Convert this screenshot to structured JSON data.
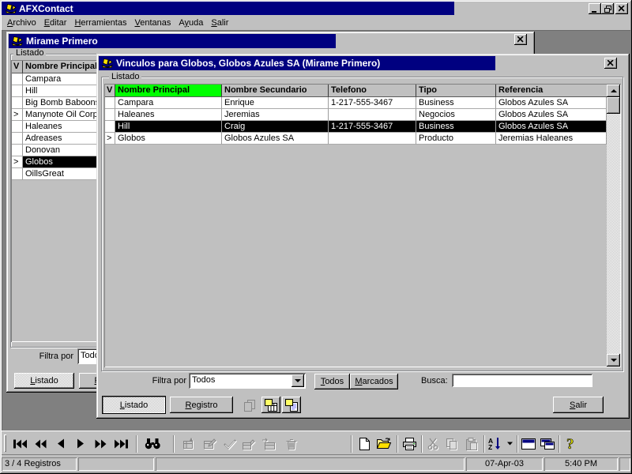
{
  "app": {
    "title": "AFXContact"
  },
  "menu": {
    "items": [
      {
        "label": "Archivo"
      },
      {
        "label": "Editar"
      },
      {
        "label": "Herramientas"
      },
      {
        "label": "Ventanas"
      },
      {
        "label": "Ayuda"
      },
      {
        "label": "Salir"
      }
    ]
  },
  "mirame_window": {
    "title": "Mirame Primero",
    "groupbox_label": "Listado",
    "table": {
      "headers": [
        "V",
        "Nombre Principal"
      ],
      "rows": [
        {
          "v": "",
          "cells": [
            "Campara"
          ]
        },
        {
          "v": "",
          "cells": [
            "Hill"
          ]
        },
        {
          "v": "",
          "cells": [
            "Big Bomb Baboons"
          ]
        },
        {
          "v": ">",
          "cells": [
            "Manynote Oil Corp."
          ]
        },
        {
          "v": "",
          "cells": [
            "Haleanes"
          ]
        },
        {
          "v": "",
          "cells": [
            "Adreases"
          ]
        },
        {
          "v": "",
          "cells": [
            "Donovan"
          ]
        },
        {
          "v": ">",
          "cells": [
            "Globos"
          ],
          "selected": true
        },
        {
          "v": "",
          "cells": [
            "OillsGreat"
          ]
        }
      ]
    },
    "filter_label": "Filtra por",
    "filter_value": "Todos",
    "listado_button": "Listado",
    "registro_button": "Registro"
  },
  "vinculos_window": {
    "title": "Vinculos para Globos, Globos Azules SA (Mirame Primero)",
    "groupbox_label": "Listado",
    "table": {
      "headers": [
        "V",
        "Nombre Principal",
        "Nombre Secundario",
        "Telefono",
        "Tipo",
        "Referencia"
      ],
      "highlighted_header": "Nombre Principal",
      "rows": [
        {
          "v": "",
          "cells": [
            "Campara",
            "Enrique",
            "1-217-555-3467",
            "Business",
            "Globos Azules SA"
          ]
        },
        {
          "v": "",
          "cells": [
            "Haleanes",
            "Jeremias",
            "",
            "Negocios",
            "Globos Azules SA"
          ]
        },
        {
          "v": "",
          "cells": [
            "Hill",
            "Craig",
            "1-217-555-3467",
            "Business",
            "Globos Azules SA"
          ],
          "selected": true
        },
        {
          "v": ">",
          "cells": [
            "Globos",
            "Globos Azules SA",
            "",
            "Producto",
            "Jeremias Haleanes"
          ]
        }
      ]
    },
    "filter_label": "Filtra por",
    "filter_value": "Todos",
    "todos_button": "Todos",
    "marcados_button": "Marcados",
    "busca_label": "Busca:",
    "busca_value": "",
    "listado_button": "Listado",
    "registro_button": "Registro",
    "salir_button": "Salir"
  },
  "toolbar": {
    "items": [
      "first-record",
      "previous-page",
      "previous-record",
      "next-record",
      "next-page",
      "last-record",
      "find",
      "insert-record",
      "change-record",
      "confirm",
      "copy-record",
      "move-record",
      "delete-record",
      "new",
      "open",
      "print",
      "cut",
      "copy",
      "paste",
      "sort-az",
      "sort-options",
      "window-list",
      "window-cascade",
      "help"
    ]
  },
  "statusbar": {
    "records": "3 / 4 Registros",
    "date": "07-Apr-03",
    "time": "5:40 PM"
  },
  "colors": {
    "titlebar": "#000080",
    "header_highlight": "#00ff00",
    "desktop": "#808080",
    "face": "#c0c0c0"
  }
}
